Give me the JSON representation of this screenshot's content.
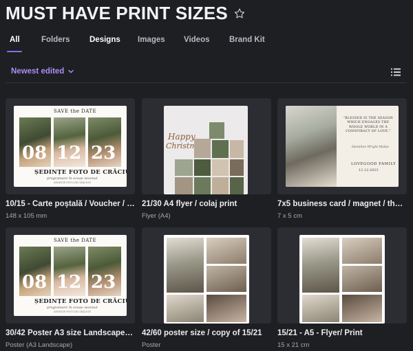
{
  "header": {
    "title": "MUST HAVE PRINT SIZES"
  },
  "tabs": [
    {
      "label": "All"
    },
    {
      "label": "Folders"
    },
    {
      "label": "Designs"
    },
    {
      "label": "Images"
    },
    {
      "label": "Videos"
    },
    {
      "label": "Brand Kit"
    }
  ],
  "sort": {
    "label": "Newest edited"
  },
  "colors": {
    "accent": "#8b6cf0",
    "background": "#1e1f23",
    "card": "#2c2d32"
  },
  "cards": [
    {
      "title": "10/15 - Carte poștală / Voucher / Tha...",
      "subtitle": "148 x 105 mm",
      "design": {
        "heading": "SAVE the DATE",
        "date": [
          "08",
          "12",
          "23"
        ],
        "caption": "ȘEDINȚE FOTO DE CRĂCIUN",
        "tagline": "programare în ecușe sezonul",
        "small": "ȘEDINȚE FOTO DE CRĂCIUN"
      }
    },
    {
      "title": "21/30 A4 flyer / colaj print",
      "subtitle": "Flyer (A4)",
      "design": {
        "script1": "Happy",
        "script2": "Christmas"
      }
    },
    {
      "title": "7x5 business card / magnet / thank yo...",
      "subtitle": "7 x 5 cm",
      "design": {
        "quote": "\"BLESSED IS THE SEASON WHICH ENGAGES THE WHOLE WORLD IN A CONSPIRACY OF LOVE.\"",
        "author": "Hamilton Wright Mabie",
        "family": "LOVEGOOD FAMILY",
        "date": "12.12.2023"
      }
    },
    {
      "title": "30/42 Poster A3 size Landscape / cop...",
      "subtitle": "Poster (A3 Landscape)",
      "design": {
        "heading": "SAVE the DATE",
        "date": [
          "08",
          "12",
          "23"
        ],
        "caption": "ȘEDINȚE FOTO DE CRĂCIUN",
        "tagline": "programare în ecușe sezonul",
        "small": "ȘEDINȚE FOTO DE CRĂCIUN"
      }
    },
    {
      "title": "42/60 poster size / copy of 15/21",
      "subtitle": "Poster"
    },
    {
      "title": "15/21 - A5 - Flyer/ Print",
      "subtitle": "15 x 21 cm"
    }
  ]
}
